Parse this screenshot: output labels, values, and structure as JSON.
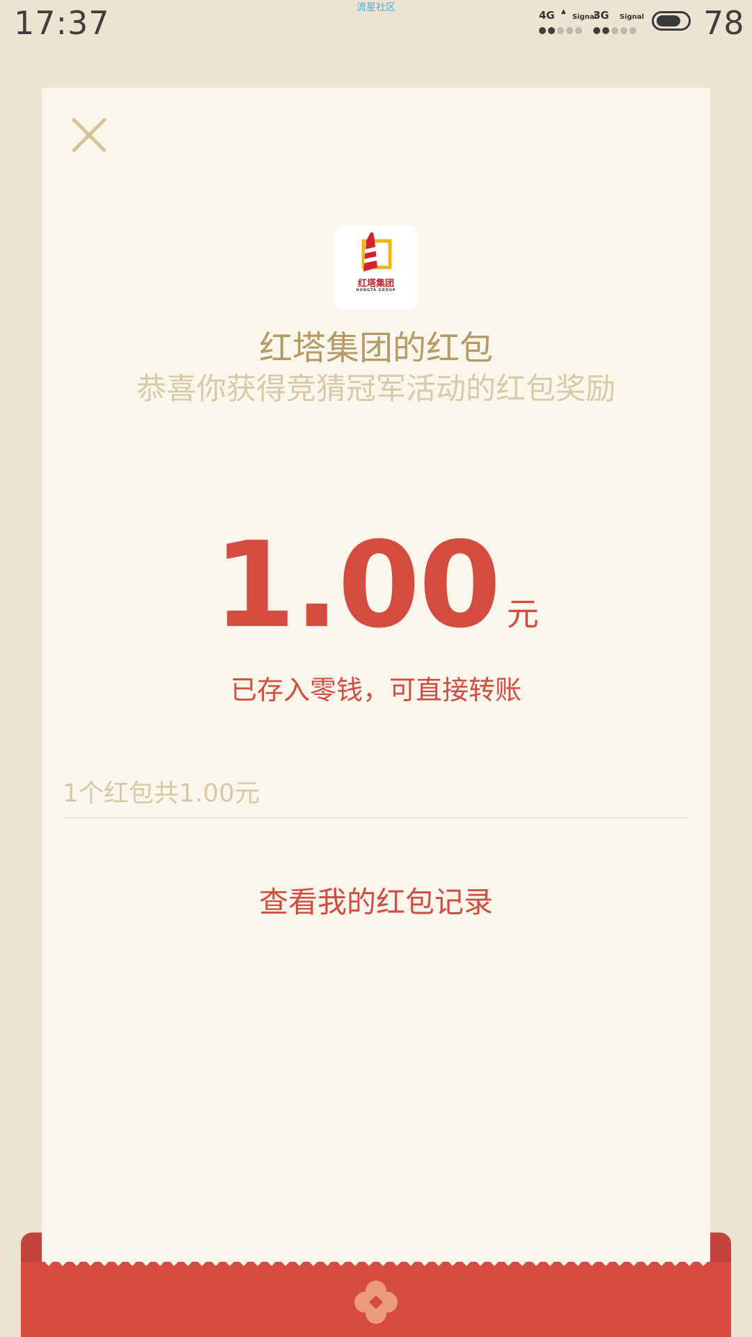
{
  "status_bar": {
    "time": "17:37",
    "watermark": "流星社区",
    "network_1": "4G",
    "network_1_sub": "Signal",
    "network_2": "3G",
    "network_2_sub": "Signal",
    "battery_percent": "78",
    "battery_level": 0.78
  },
  "card": {
    "close_icon": "close-icon",
    "logo_name": "红塔集团",
    "logo_subtext": "HONGTA GROUP",
    "sender_title": "红塔集团的红包",
    "greeting": "恭喜你获得竞猜冠军活动的红包奖励",
    "amount": "1.00",
    "amount_unit": "元",
    "wallet_note": "已存入零钱，可直接转账",
    "summary": "1个红包共1.00元",
    "records_link": "查看我的红包记录"
  },
  "colors": {
    "background": "#ece3d1",
    "card": "#faf6ec",
    "accent_red": "#d44b40",
    "gold_title": "#b49a64",
    "muted_gold": "#d8c9a7"
  }
}
